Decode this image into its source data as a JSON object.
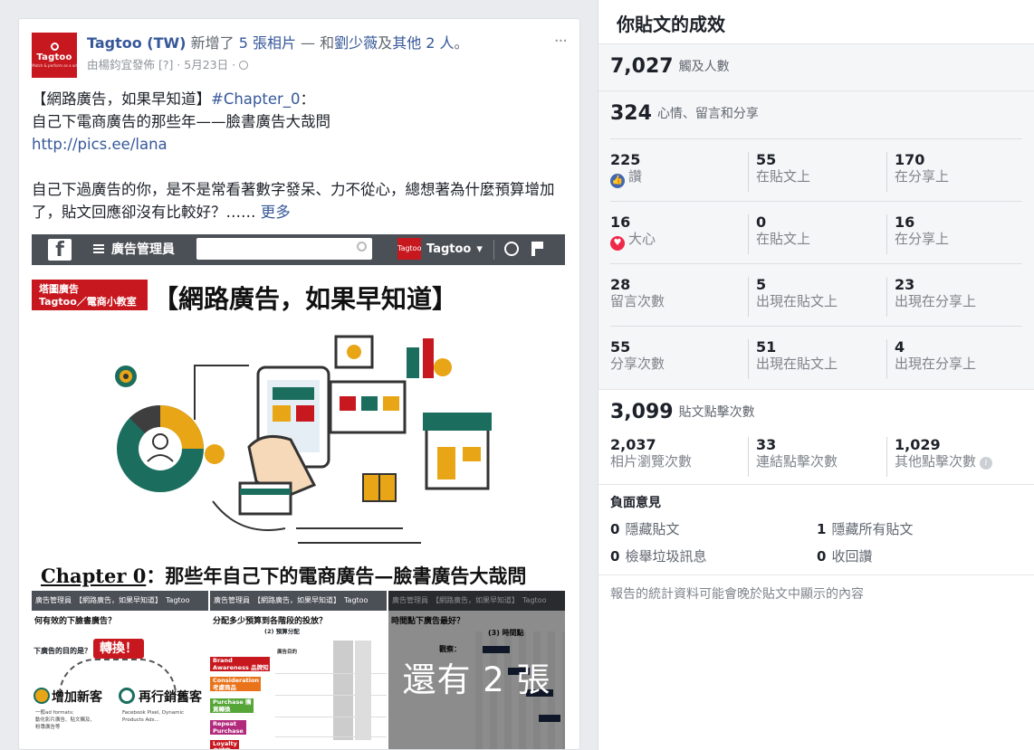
{
  "post": {
    "page_name": "Tagtoo (TW)",
    "logo_text": "Tagtoo",
    "logo_tagline": "Match & perform as a ad",
    "action_prefix": " 新增了 ",
    "photos_link": "5 張相片",
    "with_text": " — 和",
    "person_link": "劉少薇",
    "and_text": "及",
    "others_link": "其他 2 人",
    "period": "。",
    "posted_by": "由楊鈞宜發佈 [?] · 5月23日 · ",
    "more_menu": "···",
    "text_line1_a": "【網路廣告，如果早知道】",
    "text_line1_hashtag": "#Chapter_0",
    "text_line1_b": "：",
    "text_line2": "自己下電商廣告的那些年——臉書廣告大哉問",
    "text_url": "http://pics.ee/lana",
    "text_para2": "自己下過廣告的你，是不是常看著數字發呆、力不從心，總想著為什麼預算增加了，貼文回應卻沒有比較好？…… ",
    "see_more": "更多"
  },
  "main_image": {
    "bar_menu": "廣告管理員",
    "bar_account": "Tagtoo",
    "bar_logo": "Tagtoo",
    "banner_tag_line1": "塔圖廣告",
    "banner_tag_line2": "Tagtoo／電商小教室",
    "banner_title": "【網路廣告，如果早知道】",
    "caption_underlined": "Chapter 0",
    "caption_rest": "：那些年自己下的電商廣告—臉書廣告大哉問"
  },
  "thumbs": {
    "bar_text": "廣告管理員　【網路廣告，如果早知道】　Tagtoo",
    "t1_question": "何有效的下臉書廣告？",
    "t1_goal": "下廣告的目的是？",
    "t1_turn": "轉換！",
    "t1_left_label": "增加新客",
    "t1_right_label": "再行銷舊客",
    "t1_small_left": "一般ad formats:\n動化影片廣告、貼文觸及、\n粉專廣告等",
    "t1_small_right": "Facebook Pixel, Dynamic\nProducts Ads...",
    "t2_question": "分配多少預算到各階段的投放？",
    "t2_header": "(2) 預算分配",
    "t2_col_header": "廣告目的",
    "t2_stages": [
      "Brand Awareness 品牌知名度",
      "Consideration 考慮商品",
      "Purchase 購買轉換",
      "Repeat Purchase 重複購買",
      "Loyalty 忠誠度"
    ],
    "t3_question": "時間點下廣告最好？",
    "t3_header": "(3) 時間點",
    "t3_text": "觀察：",
    "more_photos": "還有 2 張"
  },
  "panel": {
    "title": "你貼文的成效",
    "reach_num": "7,027",
    "reach_label": "觸及人數",
    "eng_num": "324",
    "eng_label": "心情、留言和分享",
    "rows": [
      {
        "c1n": "225",
        "c1t": "讚",
        "c2n": "55",
        "c2t": "在貼文上",
        "c3n": "170",
        "c3t": "在分享上"
      },
      {
        "c1n": "16",
        "c1t": "大心",
        "c2n": "0",
        "c2t": "在貼文上",
        "c3n": "16",
        "c3t": "在分享上"
      },
      {
        "c1n": "28",
        "c1t": "留言次數",
        "c2n": "5",
        "c2t": "出現在貼文上",
        "c3n": "23",
        "c3t": "出現在分享上"
      },
      {
        "c1n": "55",
        "c1t": "分享次數",
        "c2n": "51",
        "c2t": "出現在貼文上",
        "c3n": "4",
        "c3t": "出現在分享上"
      }
    ],
    "clicks_num": "3,099",
    "clicks_label": "貼文點擊次數",
    "click_cells": [
      {
        "n": "2,037",
        "t": "相片瀏覽次數"
      },
      {
        "n": "33",
        "t": "連結點擊次數"
      },
      {
        "n": "1,029",
        "t": "其他點擊次數"
      }
    ],
    "neg_title": "負面意見",
    "neg": [
      {
        "n": "0",
        "t": "隱藏貼文"
      },
      {
        "n": "1",
        "t": "隱藏所有貼文"
      },
      {
        "n": "0",
        "t": "檢舉垃圾訊息"
      },
      {
        "n": "0",
        "t": "收回讚"
      }
    ],
    "footnote": "報告的統計資料可能會晚於貼文中顯示的內容"
  },
  "colors": {
    "brand_red": "#c8181f",
    "link_blue": "#365899",
    "like_blue": "#4267b2",
    "love_red": "#f02849",
    "illus_teal": "#1b6e5e",
    "illus_orange": "#e8a516"
  }
}
